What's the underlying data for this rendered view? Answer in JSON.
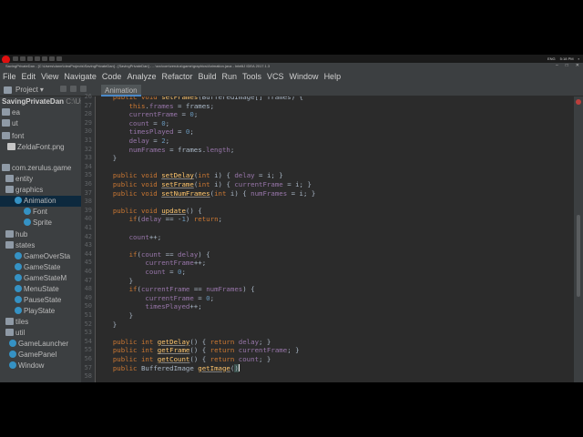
{
  "taskbar": {
    "tray_lang": "ENG",
    "tray_time": "5:18 PM"
  },
  "titlebar": {
    "title": "SavingPrivateDan - [C:\\Users\\dann\\IdeaProjects\\SavingPrivateDan] - [SavingPrivateDan] - ...\\src\\com\\zerulus\\game\\graphics\\Animation.java - IntelliJ IDEA 2017.1.3"
  },
  "menu": [
    "File",
    "Edit",
    "View",
    "Navigate",
    "Code",
    "Analyze",
    "Refactor",
    "Build",
    "Run",
    "Tools",
    "VCS",
    "Window",
    "Help"
  ],
  "toolbar": {
    "project_label": "Project",
    "editor_tab": "Animation"
  },
  "project_tree": {
    "root_name": "SavingPrivateDan",
    "root_path": "C:\\Users\\d",
    "items": [
      {
        "label": "ea",
        "icon": "folder-icon"
      },
      {
        "label": "ut",
        "icon": "folder-icon"
      },
      {
        "label": "font",
        "icon": "folder-icon"
      },
      {
        "label": "ZeldaFont.png",
        "icon": "file-icon"
      },
      {
        "label": "com.zerulus.game",
        "icon": "package-icon"
      },
      {
        "label": "entity",
        "icon": "package-icon"
      },
      {
        "label": "graphics",
        "icon": "package-icon"
      },
      {
        "label": "Animation",
        "icon": "class-icon",
        "selected": true
      },
      {
        "label": "Font",
        "icon": "class-icon"
      },
      {
        "label": "Sprite",
        "icon": "class-icon"
      },
      {
        "label": "hub",
        "icon": "package-icon"
      },
      {
        "label": "states",
        "icon": "package-icon"
      },
      {
        "label": "GameOverSta",
        "icon": "class-icon"
      },
      {
        "label": "GameState",
        "icon": "class-icon"
      },
      {
        "label": "GameStateM",
        "icon": "class-icon"
      },
      {
        "label": "MenuState",
        "icon": "class-icon"
      },
      {
        "label": "PauseState",
        "icon": "class-icon"
      },
      {
        "label": "PlayState",
        "icon": "class-icon"
      },
      {
        "label": "tiles",
        "icon": "package-icon"
      },
      {
        "label": "util",
        "icon": "package-icon"
      },
      {
        "label": "GameLauncher",
        "icon": "class-icon"
      },
      {
        "label": "GamePanel",
        "icon": "class-icon"
      },
      {
        "label": "Window",
        "icon": "class-icon"
      }
    ]
  },
  "editor": {
    "line_numbers": [
      "26",
      "27",
      "28",
      "29",
      "30",
      "31",
      "32",
      "33",
      "34",
      "35",
      "36",
      "37",
      "38",
      "39",
      "40",
      "41",
      "42",
      "43",
      "44",
      "45",
      "46",
      "47",
      "48",
      "49",
      "50",
      "51",
      "52",
      "53",
      "54",
      "55",
      "56",
      "57",
      "58"
    ],
    "lines": [
      [
        {
          "t": "    "
        },
        {
          "t": "public void ",
          "c": "kw"
        },
        {
          "t": "setFrames",
          "c": "mth-plain"
        },
        {
          "t": "(BufferedImage[] frames) {"
        }
      ],
      [
        {
          "t": "        "
        },
        {
          "t": "this",
          "c": "kw"
        },
        {
          "t": "."
        },
        {
          "t": "frames",
          "c": "fld"
        },
        {
          "t": " = frames;"
        }
      ],
      [
        {
          "t": "        "
        },
        {
          "t": "currentFrame",
          "c": "fld"
        },
        {
          "t": " = "
        },
        {
          "t": "0",
          "c": "num"
        },
        {
          "t": ";"
        }
      ],
      [
        {
          "t": "        "
        },
        {
          "t": "count",
          "c": "fld"
        },
        {
          "t": " = "
        },
        {
          "t": "0",
          "c": "num"
        },
        {
          "t": ";"
        }
      ],
      [
        {
          "t": "        "
        },
        {
          "t": "timesPlayed",
          "c": "fld"
        },
        {
          "t": " = "
        },
        {
          "t": "0",
          "c": "num"
        },
        {
          "t": ";"
        }
      ],
      [
        {
          "t": "        "
        },
        {
          "t": "delay",
          "c": "fld"
        },
        {
          "t": " = "
        },
        {
          "t": "2",
          "c": "num"
        },
        {
          "t": ";"
        }
      ],
      [
        {
          "t": "        "
        },
        {
          "t": "numFrames",
          "c": "fld"
        },
        {
          "t": " = frames."
        },
        {
          "t": "length",
          "c": "fld"
        },
        {
          "t": ";"
        }
      ],
      [
        {
          "t": "    }"
        }
      ],
      [
        {
          "t": ""
        }
      ],
      [
        {
          "t": "    "
        },
        {
          "t": "public void ",
          "c": "kw"
        },
        {
          "t": "setDelay",
          "c": "mth"
        },
        {
          "t": "("
        },
        {
          "t": "int ",
          "c": "kw"
        },
        {
          "t": "i) { "
        },
        {
          "t": "delay",
          "c": "fld"
        },
        {
          "t": " = i; }"
        }
      ],
      [
        {
          "t": "    "
        },
        {
          "t": "public void ",
          "c": "kw"
        },
        {
          "t": "setFrame",
          "c": "mth"
        },
        {
          "t": "("
        },
        {
          "t": "int ",
          "c": "kw"
        },
        {
          "t": "i) { "
        },
        {
          "t": "currentFrame",
          "c": "fld"
        },
        {
          "t": " = i; }"
        }
      ],
      [
        {
          "t": "    "
        },
        {
          "t": "public void ",
          "c": "kw"
        },
        {
          "t": "setNumFrames",
          "c": "mth"
        },
        {
          "t": "("
        },
        {
          "t": "int ",
          "c": "kw"
        },
        {
          "t": "i) { "
        },
        {
          "t": "numFrames",
          "c": "fld"
        },
        {
          "t": " = i; }"
        }
      ],
      [
        {
          "t": ""
        }
      ],
      [
        {
          "t": "    "
        },
        {
          "t": "public void ",
          "c": "kw"
        },
        {
          "t": "update",
          "c": "mth"
        },
        {
          "t": "() {"
        }
      ],
      [
        {
          "t": "        "
        },
        {
          "t": "if",
          "c": "kw"
        },
        {
          "t": "("
        },
        {
          "t": "delay",
          "c": "fld"
        },
        {
          "t": " == -"
        },
        {
          "t": "1",
          "c": "num"
        },
        {
          "t": ") "
        },
        {
          "t": "return",
          "c": "kw"
        },
        {
          "t": ";"
        }
      ],
      [
        {
          "t": ""
        }
      ],
      [
        {
          "t": "        "
        },
        {
          "t": "count",
          "c": "fld"
        },
        {
          "t": "++;"
        }
      ],
      [
        {
          "t": ""
        }
      ],
      [
        {
          "t": "        "
        },
        {
          "t": "if",
          "c": "kw"
        },
        {
          "t": "("
        },
        {
          "t": "count",
          "c": "fld"
        },
        {
          "t": " == "
        },
        {
          "t": "delay",
          "c": "fld"
        },
        {
          "t": ") {"
        }
      ],
      [
        {
          "t": "            "
        },
        {
          "t": "currentFrame",
          "c": "fld"
        },
        {
          "t": "++;"
        }
      ],
      [
        {
          "t": "            "
        },
        {
          "t": "count",
          "c": "fld"
        },
        {
          "t": " = "
        },
        {
          "t": "0",
          "c": "num"
        },
        {
          "t": ";"
        }
      ],
      [
        {
          "t": "        }"
        }
      ],
      [
        {
          "t": "        "
        },
        {
          "t": "if",
          "c": "kw"
        },
        {
          "t": "("
        },
        {
          "t": "currentFrame",
          "c": "fld"
        },
        {
          "t": " == "
        },
        {
          "t": "numFrames",
          "c": "fld"
        },
        {
          "t": ") {"
        }
      ],
      [
        {
          "t": "            "
        },
        {
          "t": "currentFrame",
          "c": "fld"
        },
        {
          "t": " = "
        },
        {
          "t": "0",
          "c": "num"
        },
        {
          "t": ";"
        }
      ],
      [
        {
          "t": "            "
        },
        {
          "t": "timesPlayed",
          "c": "fld"
        },
        {
          "t": "++;"
        }
      ],
      [
        {
          "t": "        }"
        }
      ],
      [
        {
          "t": "    }"
        }
      ],
      [
        {
          "t": ""
        }
      ],
      [
        {
          "t": "    "
        },
        {
          "t": "public int ",
          "c": "kw"
        },
        {
          "t": "getDelay",
          "c": "mth"
        },
        {
          "t": "() { "
        },
        {
          "t": "return ",
          "c": "kw"
        },
        {
          "t": "delay",
          "c": "fld"
        },
        {
          "t": "; }"
        }
      ],
      [
        {
          "t": "    "
        },
        {
          "t": "public int ",
          "c": "kw"
        },
        {
          "t": "getFrame",
          "c": "mth"
        },
        {
          "t": "() { "
        },
        {
          "t": "return ",
          "c": "kw"
        },
        {
          "t": "currentFrame",
          "c": "fld"
        },
        {
          "t": "; }"
        }
      ],
      [
        {
          "t": "    "
        },
        {
          "t": "public int ",
          "c": "kw"
        },
        {
          "t": "getCount",
          "c": "mth"
        },
        {
          "t": "() { "
        },
        {
          "t": "return ",
          "c": "kw"
        },
        {
          "t": "count",
          "c": "fld"
        },
        {
          "t": "; }"
        }
      ],
      [
        {
          "t": "    "
        },
        {
          "t": "public ",
          "c": "kw"
        },
        {
          "t": "BufferedImage "
        },
        {
          "t": "getImage",
          "c": "mth"
        },
        {
          "t": "("
        },
        {
          "t": ")",
          "c": "cursor-after"
        }
      ],
      [
        {
          "t": ""
        }
      ]
    ]
  },
  "colors": {
    "editor_bg": "#2b2b2b",
    "panel_bg": "#3c3f41",
    "keyword": "#cc7832",
    "field": "#9876aa",
    "method": "#ffc66d",
    "number": "#6897bb",
    "recording": "#e01010"
  }
}
